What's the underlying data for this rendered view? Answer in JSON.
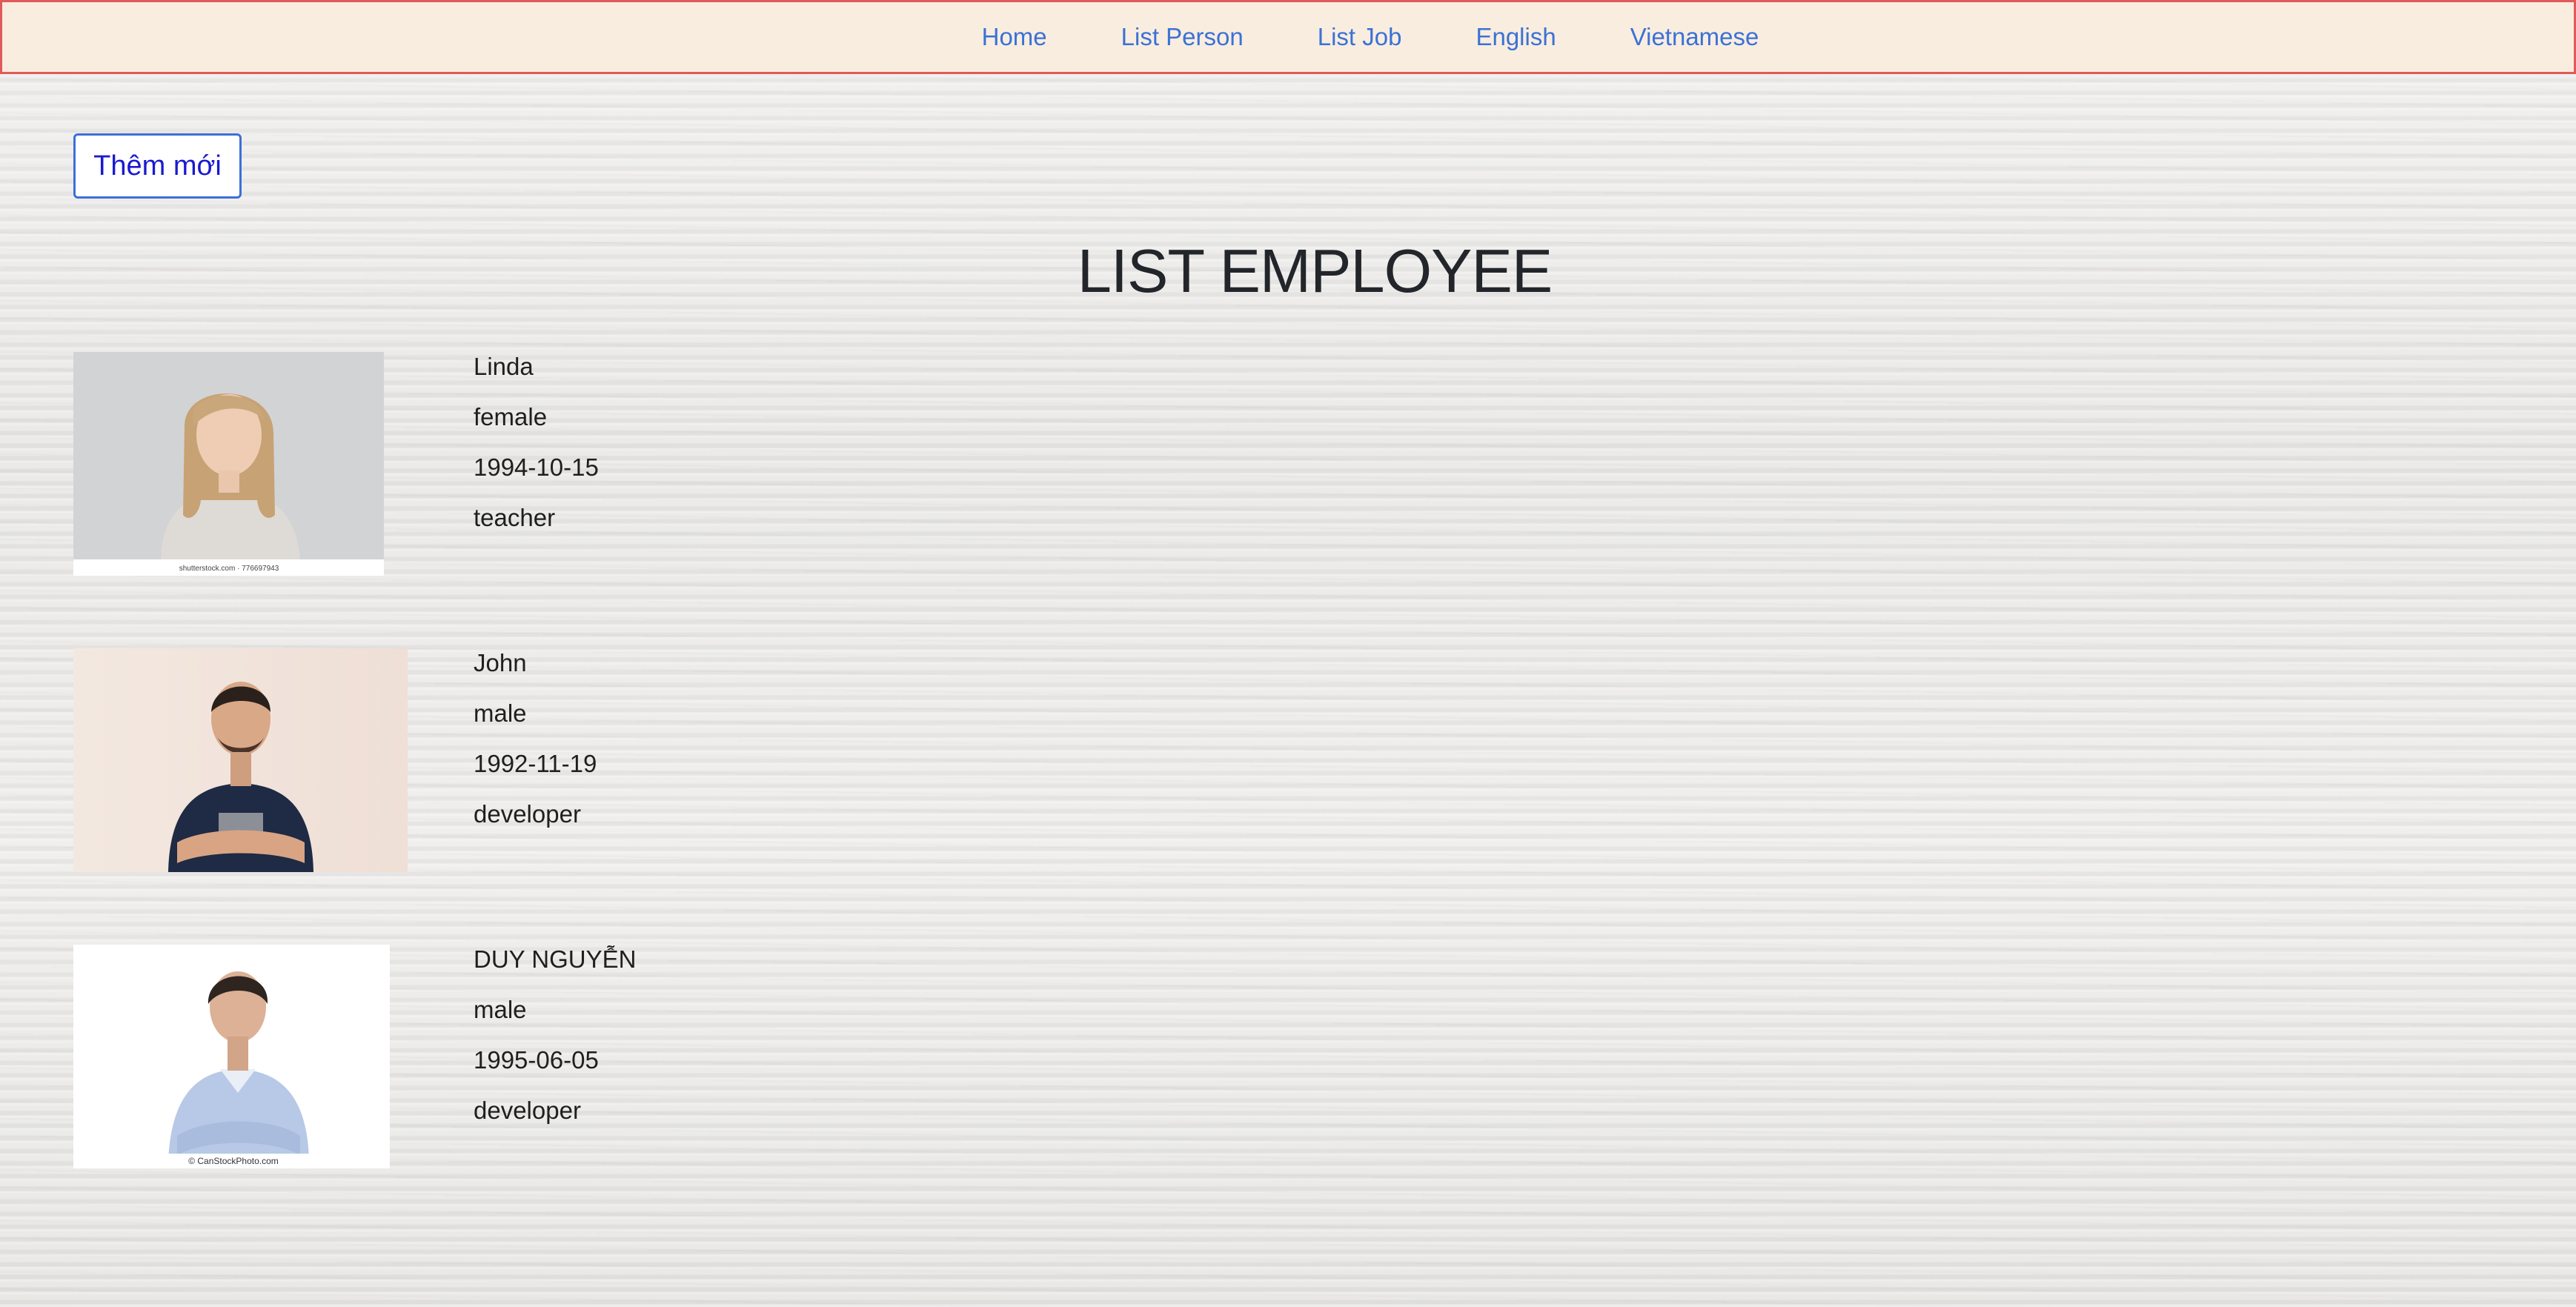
{
  "nav": {
    "items": [
      {
        "label": "Home"
      },
      {
        "label": "List Person"
      },
      {
        "label": "List Job"
      },
      {
        "label": "English"
      },
      {
        "label": "Vietnamese"
      }
    ]
  },
  "add_button_label": "Thêm mới",
  "page_title": "LIST EMPLOYEE",
  "employees": [
    {
      "name": "Linda",
      "gender": "female",
      "birthday": "1994-10-15",
      "job": "teacher",
      "photo_caption": "shutterstock.com · 776697943"
    },
    {
      "name": "John",
      "gender": "male",
      "birthday": "1992-11-19",
      "job": "developer"
    },
    {
      "name": "DUY NGUYỄN",
      "gender": "male",
      "birthday": "1995-06-05",
      "job": "developer",
      "photo_caption": "© CanStockPhoto.com"
    }
  ],
  "colors": {
    "navbar_bg": "#f9ede0",
    "navbar_border": "#e05a5a",
    "link": "#3a72d6",
    "button_border": "#3d6fd8",
    "button_text": "#1a1ad0",
    "title": "#222529"
  }
}
